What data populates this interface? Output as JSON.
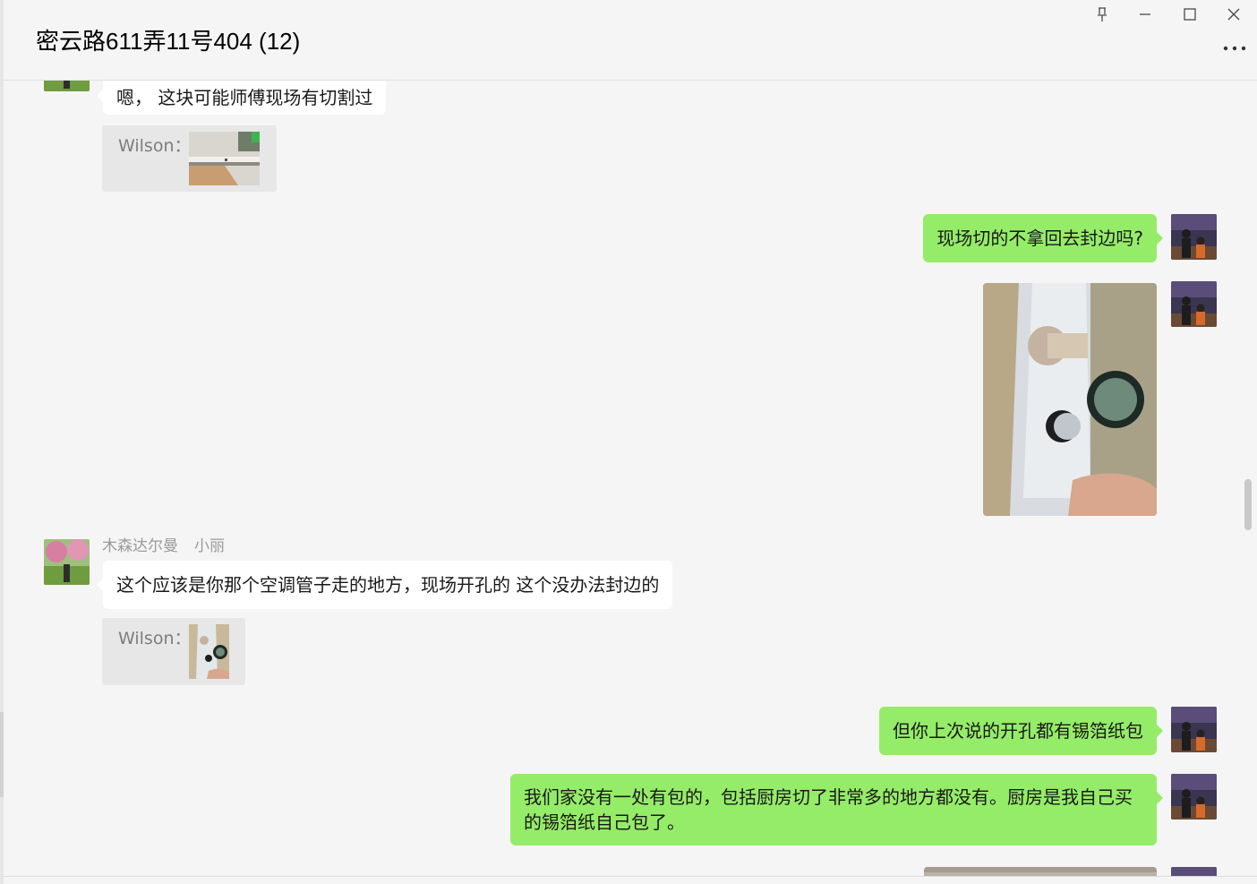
{
  "window": {
    "title": "密云路611弄11号404 (12)",
    "controls": {
      "pin_icon": "pin-icon",
      "minimize_icon": "minimize-icon",
      "maximize_icon": "maximize-icon",
      "close_icon": "close-icon",
      "more_icon": "more-icon"
    }
  },
  "colors": {
    "background": "#f5f5f5",
    "bubble_self": "#95ec69",
    "bubble_other": "#ffffff",
    "quote_bg": "#e7e7e7",
    "sender_text": "#9a9a9a"
  },
  "messages": [
    {
      "side": "left",
      "text": "嗯， 这块可能师傅现场有切割过",
      "quote": {
        "name": "Wilson：",
        "thumb": "image"
      }
    },
    {
      "side": "right",
      "text": "现场切的不拿回去封边吗?"
    },
    {
      "side": "right",
      "type": "image"
    },
    {
      "side": "left",
      "sender": {
        "nickname": "木森达尔曼",
        "name": "小丽"
      },
      "text": "这个应该是你那个空调管子走的地方，现场开孔的 这个没办法封边的",
      "quote": {
        "name": "Wilson：",
        "thumb": "image"
      }
    },
    {
      "side": "right",
      "text": "但你上次说的开孔都有锡箔纸包"
    },
    {
      "side": "right",
      "text": "我们家没有一处有包的，包括厨房切了非常多的地方都没有。厨房是我自己买的锡箔纸自己包了。"
    }
  ]
}
